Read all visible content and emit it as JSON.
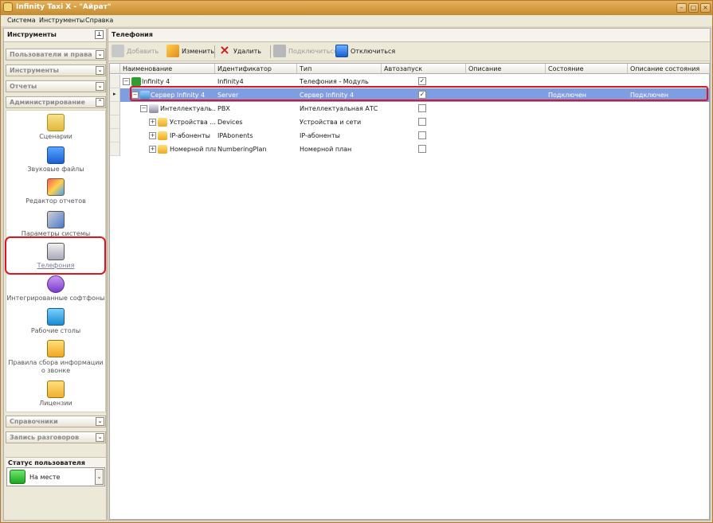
{
  "window": {
    "title": "Infinity Taxi X - \"Айрат\""
  },
  "menu": {
    "items": [
      "Система",
      "Инструменты",
      "Справка"
    ]
  },
  "left_panel": {
    "header": "Инструменты",
    "groups_top": [
      "Пользователи и права",
      "Инструменты",
      "Отчеты",
      "Администрирование"
    ],
    "admin_tools": [
      {
        "label": "Сценарии",
        "icon": "scroll-icon"
      },
      {
        "label": "Звуковые файлы",
        "icon": "play-icon"
      },
      {
        "label": "Редактор отчетов",
        "icon": "chart-edit-icon"
      },
      {
        "label": "Параметры системы",
        "icon": "tools-icon"
      },
      {
        "label": "Телефония",
        "icon": "telephony-icon"
      },
      {
        "label": "Интегрированные софтфоны",
        "icon": "phone-handset-icon"
      },
      {
        "label": "Рабочие столы",
        "icon": "desktop-icon"
      },
      {
        "label": "Правила сбора информации о звонке",
        "icon": "rules-icon"
      },
      {
        "label": "Лицензии",
        "icon": "license-icon"
      }
    ],
    "groups_bottom": [
      "Справочники",
      "Запись разговоров"
    ],
    "user_status": {
      "title": "Статус пользователя",
      "value": "На месте"
    }
  },
  "right_panel": {
    "header": "Телефония",
    "toolbar": {
      "add": "Добавить",
      "edit": "Изменить",
      "delete": "Удалить",
      "connect": "Подключиться",
      "disconnect": "Отключиться"
    },
    "columns": [
      "Наименование",
      "Идентификатор",
      "Тип",
      "Автозапуск",
      "Описание",
      "Состояние",
      "Описание состояния"
    ],
    "rows": [
      {
        "name": "Infinity 4",
        "id": "Infinity4",
        "type": "Телефония - Модуль",
        "autostart": true,
        "description": "",
        "state": "",
        "state_description": ""
      },
      {
        "name": "Сервер Infinity 4",
        "id": "Server",
        "type": "Сервер Infinity 4",
        "autostart": true,
        "description": "",
        "state": "Подключен",
        "state_description": "Подключен"
      },
      {
        "name": "Интеллектуаль...",
        "id": "PBX",
        "type": "Интеллектуальная АТС",
        "autostart": false,
        "description": "",
        "state": "",
        "state_description": ""
      },
      {
        "name": "Устройства ...",
        "id": "Devices",
        "type": "Устройства и сети",
        "autostart": false,
        "description": "",
        "state": "",
        "state_description": ""
      },
      {
        "name": "IP-абоненты",
        "id": "IPAbonents",
        "type": "IP-абоненты",
        "autostart": false,
        "description": "",
        "state": "",
        "state_description": ""
      },
      {
        "name": "Номерной план",
        "id": "NumberingPlan",
        "type": "Номерной план",
        "autostart": false,
        "description": "",
        "state": "",
        "state_description": ""
      }
    ]
  },
  "colors": {
    "title_bar": "#c68a2f",
    "selection": "#7f9ee1",
    "highlight_outline": "#e0141e",
    "status_online": "#2fbf2f"
  }
}
